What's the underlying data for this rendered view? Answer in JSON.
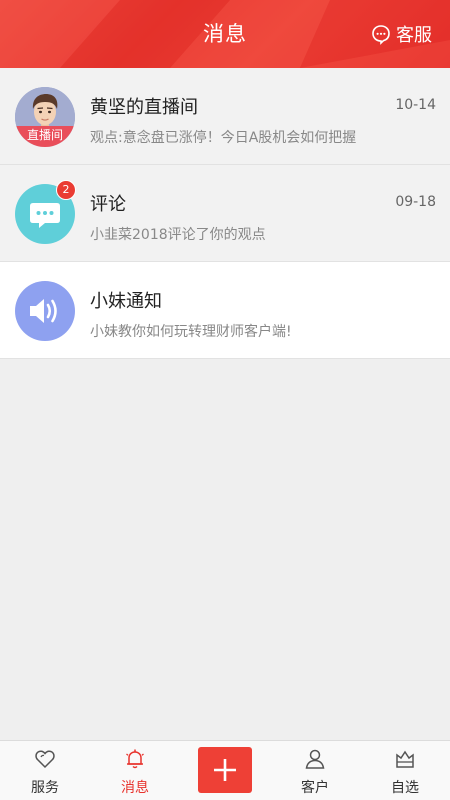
{
  "header": {
    "title": "消息",
    "service_label": "客服",
    "service_icon": "chat-bubble-icon",
    "color": "#e8332d"
  },
  "messages": [
    {
      "title": "黄坚的直播间",
      "time": "10-14",
      "preview": "观点:意念盘已涨停！今日A股机会如何把握",
      "avatar_label": "直播间",
      "icon": "host-portrait-avatar"
    },
    {
      "title": "评论",
      "time": "09-18",
      "preview": "小韭菜2018评论了你的观点",
      "badge": "2",
      "icon": "comment-bubble-icon",
      "icon_color": "#5fcfd9"
    },
    {
      "title": "小妹通知",
      "preview": "小妹教你如何玩转理财师客户端!",
      "icon": "speaker-icon",
      "icon_color": "#8ea1f0"
    }
  ],
  "tabbar": {
    "tabs": [
      {
        "label": "服务",
        "icon": "heart-icon"
      },
      {
        "label": "消息",
        "icon": "bell-icon",
        "active": true
      },
      {
        "label": "客户",
        "icon": "person-icon"
      },
      {
        "label": "自选",
        "icon": "crown-box-icon"
      }
    ],
    "add_icon": "plus-icon",
    "active_color": "#e8332d"
  }
}
